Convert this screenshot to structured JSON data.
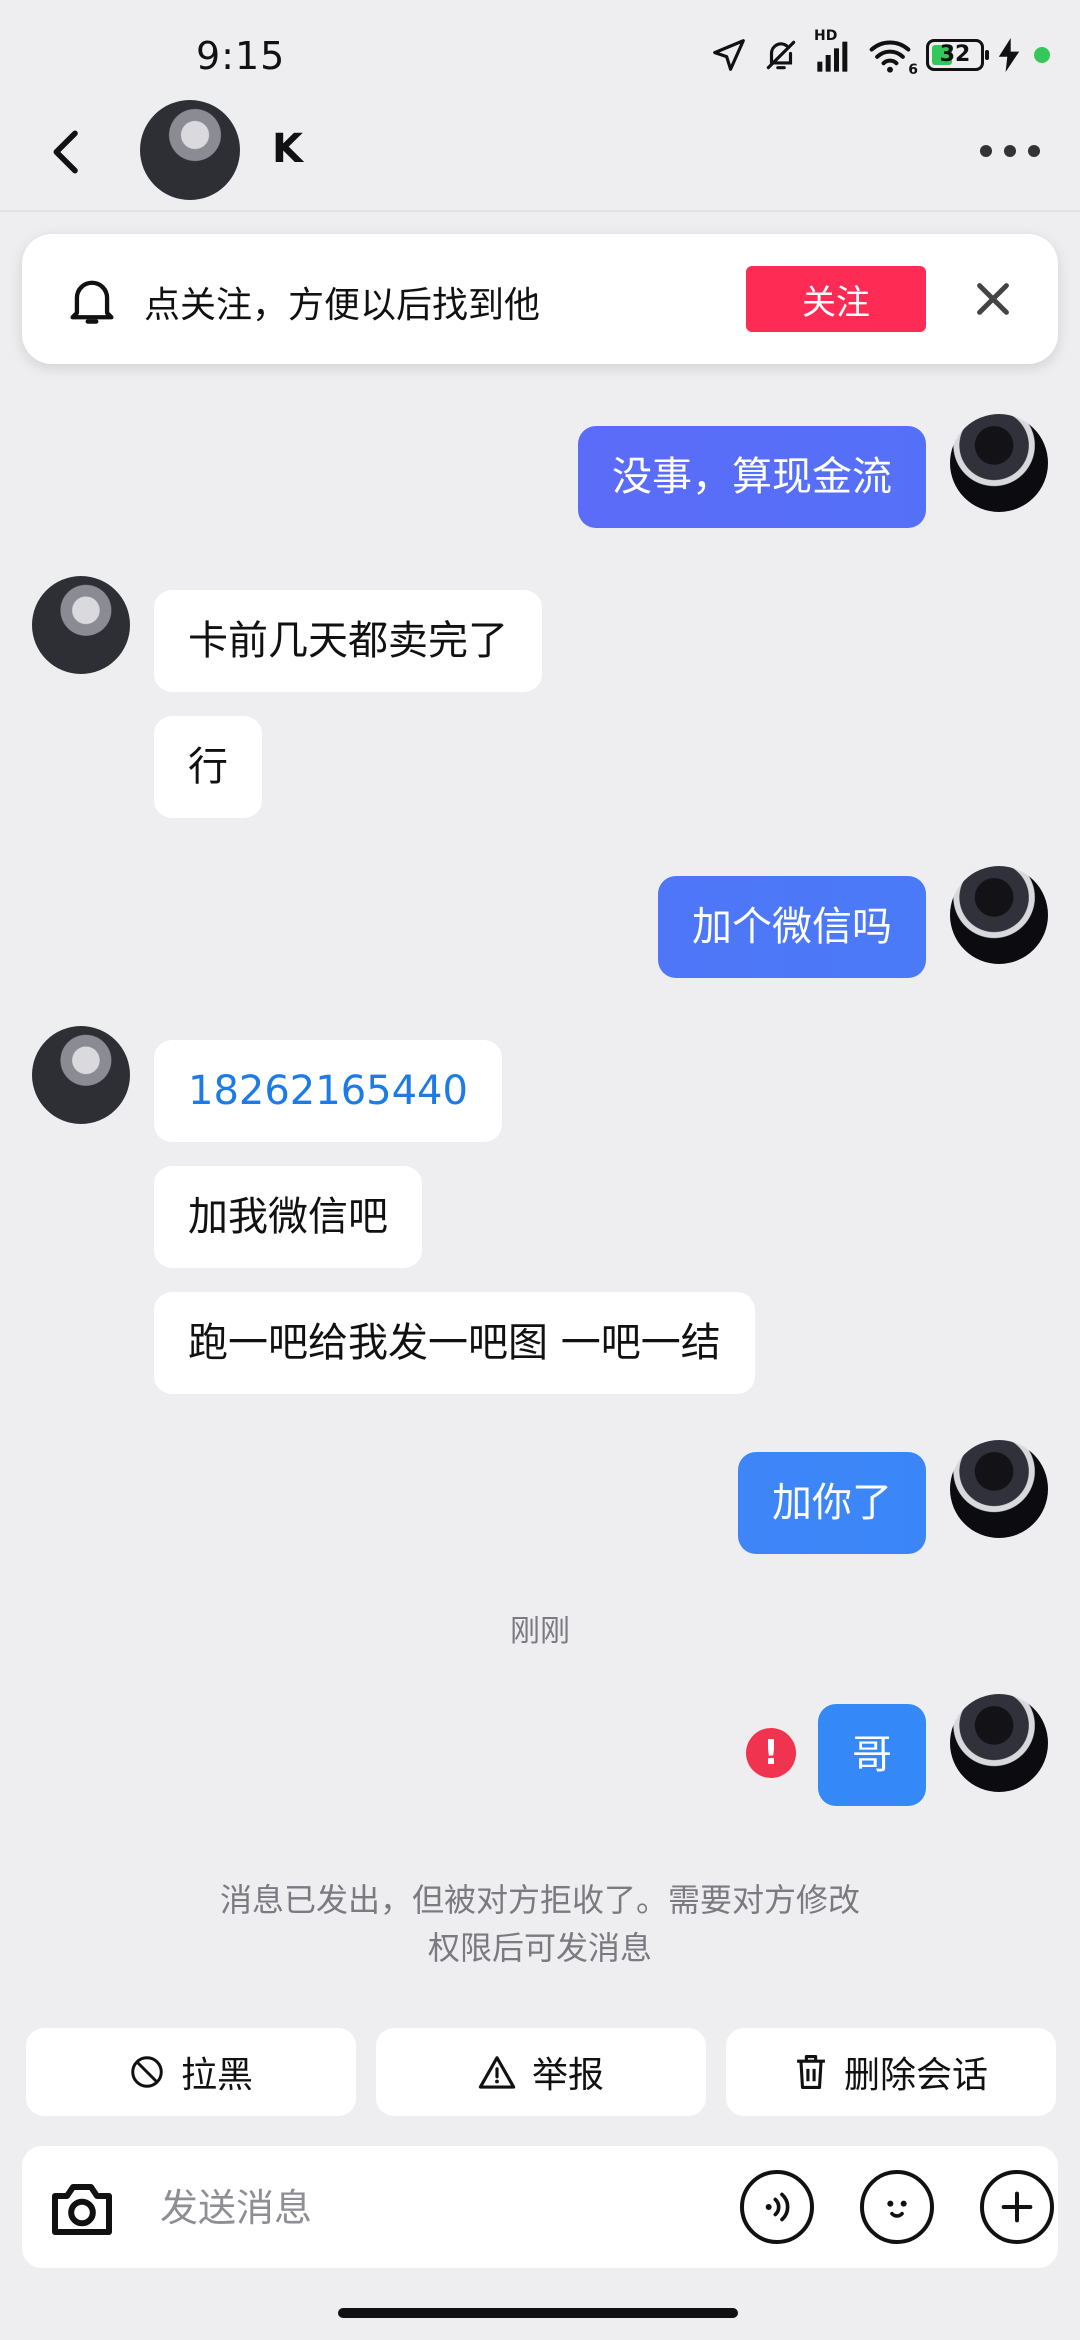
{
  "status_bar": {
    "time": "9:15",
    "battery_level": "32",
    "hd_label": "HD",
    "wifi_label": "6",
    "icons": [
      "location-arrow-icon",
      "mute-bell-icon",
      "signal-icon",
      "wifi-icon",
      "battery-icon",
      "charging-icon"
    ]
  },
  "header": {
    "contact_name": "K",
    "back_icon": "chevron-left-icon",
    "more_icon": "ellipsis-icon"
  },
  "follow_banner": {
    "text": "点关注，方便以后找到他",
    "button_label": "关注",
    "accent": "#fe2c55"
  },
  "messages": [
    {
      "side": "out",
      "text": "没事，算现金流"
    },
    {
      "side": "in",
      "text": "卡前几天都卖完了"
    },
    {
      "side": "in",
      "text": "行"
    },
    {
      "side": "out",
      "text": "加个微信吗"
    },
    {
      "side": "in",
      "text": "18262165440"
    },
    {
      "side": "in",
      "text": "加我微信吧"
    },
    {
      "side": "in",
      "text": "跑一吧给我发一吧图 一吧一结"
    },
    {
      "side": "out",
      "text": "加你了"
    },
    {
      "side": "out",
      "text": "哥",
      "failed": true
    }
  ],
  "time_separator": "刚刚",
  "error_mark": "!",
  "notice": {
    "line1": "消息已发出，但被对方拒收了。需要对方修改",
    "line2": "权限后可发消息"
  },
  "actions": {
    "block_label": "拉黑",
    "report_label": "举报",
    "delete_label": "删除会话"
  },
  "input": {
    "placeholder": "发送消息",
    "value": ""
  },
  "colors": {
    "outgoing_bubble_gradient": [
      "#5b6cf8",
      "#2f8af8"
    ],
    "background": "#eeeef0",
    "error": "#f0344f"
  }
}
